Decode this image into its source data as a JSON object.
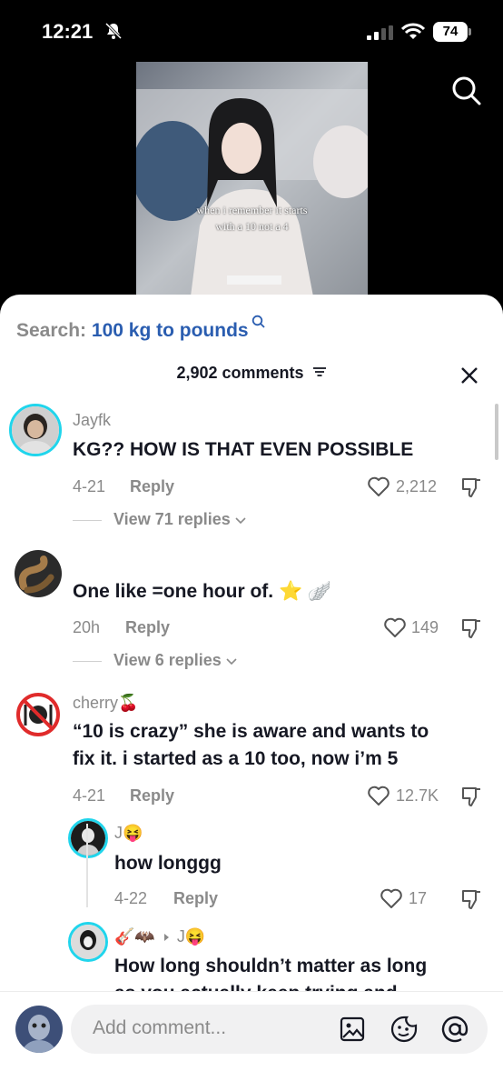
{
  "status_bar": {
    "time": "12:21",
    "battery": "74"
  },
  "video": {
    "caption_line1": "when i remember it starts",
    "caption_line2": "with a 10 not a 4"
  },
  "search": {
    "prefix": "Search:",
    "query": "100 kg to pounds"
  },
  "comments_header": {
    "count": "2,902 comments"
  },
  "comments": [
    {
      "user": "Jayfk",
      "text": "KG?? HOW IS THAT EVEN POSSIBLE",
      "date": "4-21",
      "reply": "Reply",
      "likes": "2,212",
      "view_replies": "View 71 replies"
    },
    {
      "user": "",
      "text": "One like =one hour of. ⭐ 🪽",
      "date": "20h",
      "reply": "Reply",
      "likes": "149",
      "view_replies": "View 6 replies"
    },
    {
      "user": "cherry🍒",
      "text_line1": "“10 is crazy” she is aware and wants to",
      "text_line2": "fix it. i started as a 10 too, now i’m 5",
      "date": "4-21",
      "reply": "Reply",
      "likes": "12.7K"
    }
  ],
  "replies": [
    {
      "user": "J😝",
      "text": "how longgg",
      "date": "4-22",
      "reply": "Reply",
      "likes": "17"
    },
    {
      "user": "🎸🦇",
      "reply_to": "J😝",
      "text_line1": "How long shouldn’t matter as long",
      "text_line2": "as you actually keep trying and"
    }
  ],
  "composer": {
    "placeholder": "Add comment..."
  },
  "icons": [
    "bell-slash-icon",
    "signal-icon",
    "wifi-icon",
    "battery-icon",
    "search-icon",
    "filter-icon",
    "close-icon",
    "heart-icon",
    "dislike-icon",
    "chevron-down-icon",
    "image-icon",
    "emoji-icon",
    "mention-icon"
  ],
  "colors": {
    "search_query": "#2a5db0",
    "muted": "#8a8a8a",
    "text": "#161823",
    "avatar_ring": "#20d5ec"
  }
}
